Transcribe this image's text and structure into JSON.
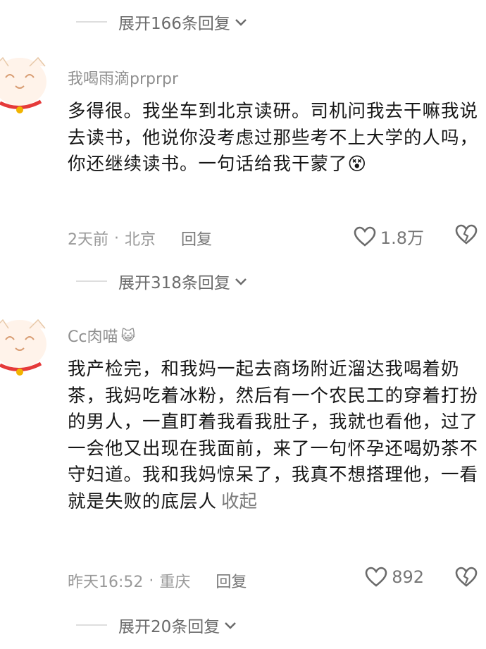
{
  "expand_top": {
    "label": "展开166条回复"
  },
  "comments": [
    {
      "username": "我喝雨滴prprpr",
      "text": "多得很。我坐车到北京读研。司机问我去干嘛我说去读书，他说你没考虑过那些考不上大学的人吗，你还继续读书。一句话给我干蒙了",
      "emoji": "😵",
      "time": "2天前",
      "location": "北京",
      "reply_label": "回复",
      "likes": "1.8万",
      "expand_label": "展开318条回复"
    },
    {
      "username": "Cc肉喵",
      "name_emoji": "😺",
      "text": "我产检完，和我妈一起去商场附近溜达我喝着奶茶，我妈吃着冰粉，然后有一个农民工的穿着打扮的男人，一直盯着我看我肚子，我就也看他，过了一会他又出现在我面前，来了一句怀孕还喝奶茶不守妇道。我和我妈惊呆了，我真不想搭理他，一看就是失败的底层人",
      "collapse_label": "收起",
      "time": "昨天16:52",
      "location": "重庆",
      "reply_label": "回复",
      "likes": "892",
      "expand_label": "展开20条回复"
    }
  ],
  "colors": {
    "text": "#161616",
    "meta": "#999999",
    "avatar_cat": "#fff3ea",
    "collar": "#e53a3a"
  },
  "icons": [
    "heart-icon",
    "broken-heart-icon",
    "chevron-down-icon",
    "cat-avatar-icon"
  ]
}
